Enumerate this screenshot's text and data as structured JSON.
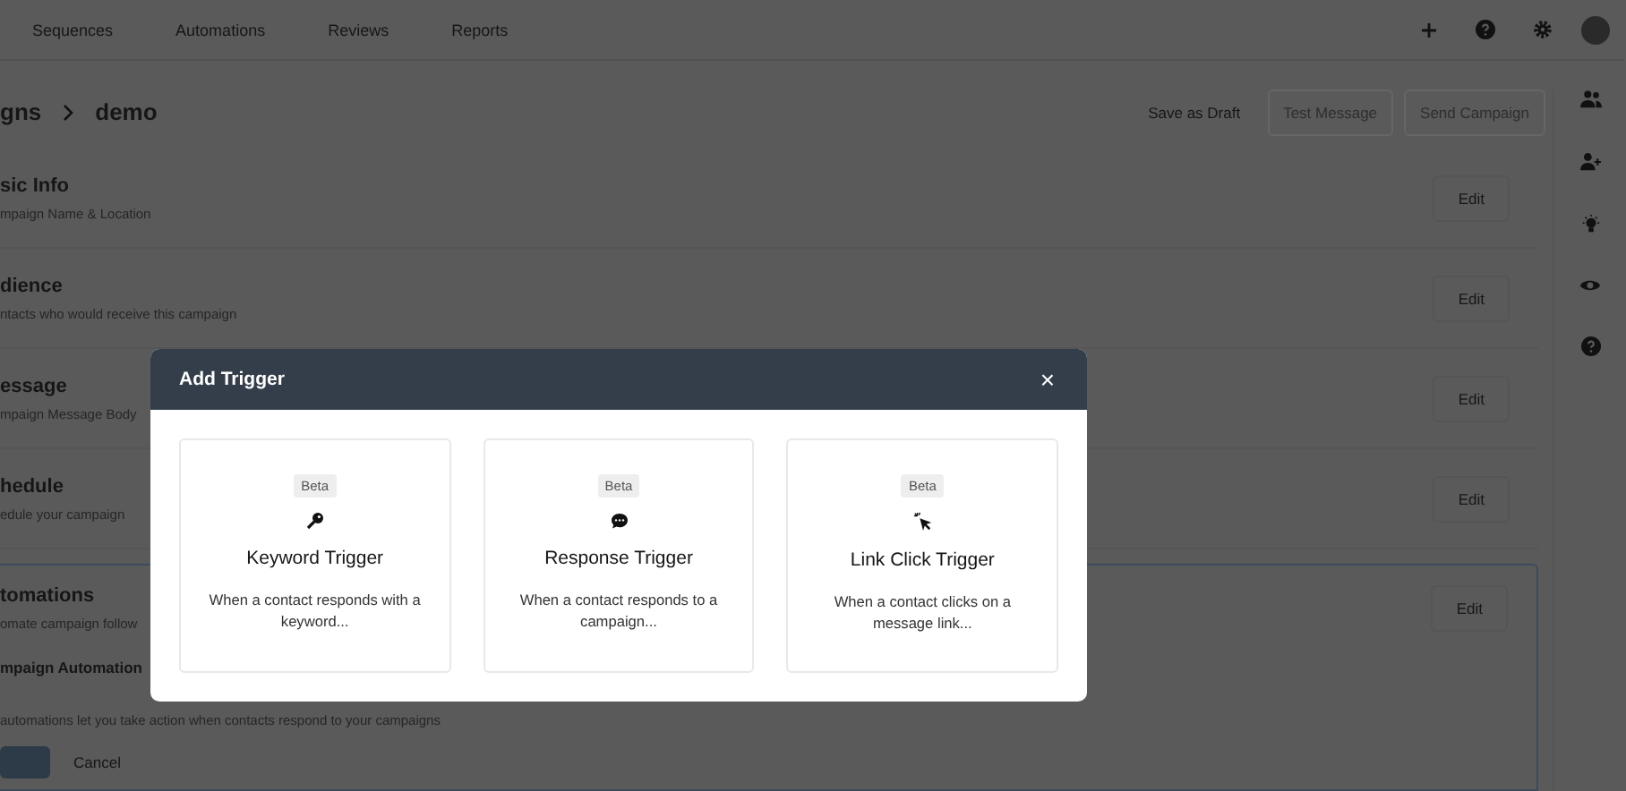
{
  "nav": {
    "items": [
      "Sequences",
      "Automations",
      "Reviews",
      "Reports"
    ]
  },
  "header": {
    "breadcrumb": [
      "gns",
      "demo"
    ],
    "actions": [
      {
        "label": "Save as Draft",
        "disabled": false
      },
      {
        "label": "Test Message",
        "disabled": true
      },
      {
        "label": "Send Campaign",
        "disabled": true
      }
    ]
  },
  "sections": [
    {
      "title": "sic Info",
      "subtitle": "mpaign Name & Location",
      "edit": "Edit",
      "highlighted": false
    },
    {
      "title": "dience",
      "subtitle": "ntacts who would receive this campaign",
      "edit": "Edit",
      "highlighted": false
    },
    {
      "title": "essage",
      "subtitle": "mpaign Message Body",
      "edit": "Edit",
      "highlighted": false
    },
    {
      "title": "hedule",
      "subtitle": "edule your campaign",
      "edit": "Edit",
      "highlighted": false
    },
    {
      "title": "tomations",
      "subtitle": "omate campaign follow",
      "edit": "Edit",
      "highlighted": true
    }
  ],
  "automation": {
    "title": "mpaign Automation",
    "description": "automations let you take action when contacts respond to your campaigns",
    "cancel": "Cancel"
  },
  "modal": {
    "title": "Add Trigger",
    "close": "×",
    "triggers": [
      {
        "kind": "key",
        "badge": "Beta",
        "title": "Keyword Trigger",
        "description": "When a contact responds with a keyword..."
      },
      {
        "kind": "chat",
        "badge": "Beta",
        "title": "Response Trigger",
        "description": "When a contact responds to a campaign..."
      },
      {
        "kind": "cursor",
        "badge": "Beta",
        "title": "Link Click Trigger",
        "description": "When a contact clicks on a message link..."
      }
    ]
  }
}
